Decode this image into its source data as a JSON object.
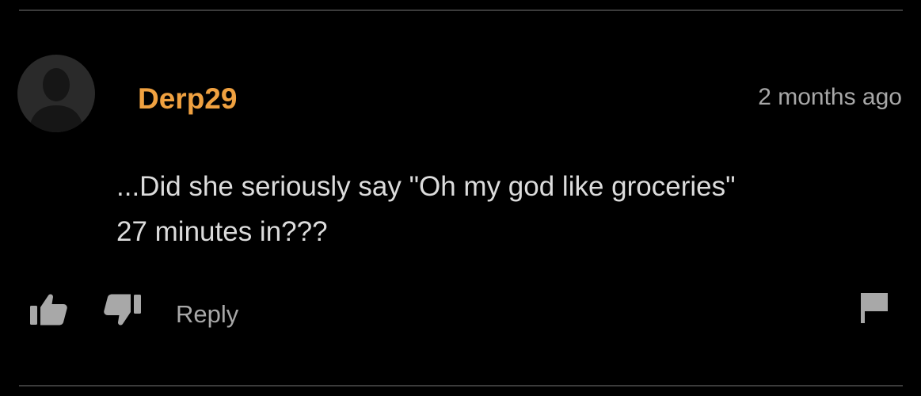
{
  "comment": {
    "username": "Derp29",
    "timestamp": "2 months ago",
    "text_lines": [
      "...Did she seriously say \"Oh my god like groceries\"",
      "27 minutes in???"
    ],
    "avatar_icon": "default-user-silhouette-icon"
  },
  "actions": {
    "like_icon": "thumbs-up-icon",
    "dislike_icon": "thumbs-down-icon",
    "reply_label": "Reply",
    "flag_icon": "flag-icon"
  },
  "colors": {
    "background": "#000000",
    "username": "#f0a140",
    "body_text": "#dcdcdc",
    "muted_text": "#a8a8a8",
    "divider": "#3b3b3b"
  }
}
